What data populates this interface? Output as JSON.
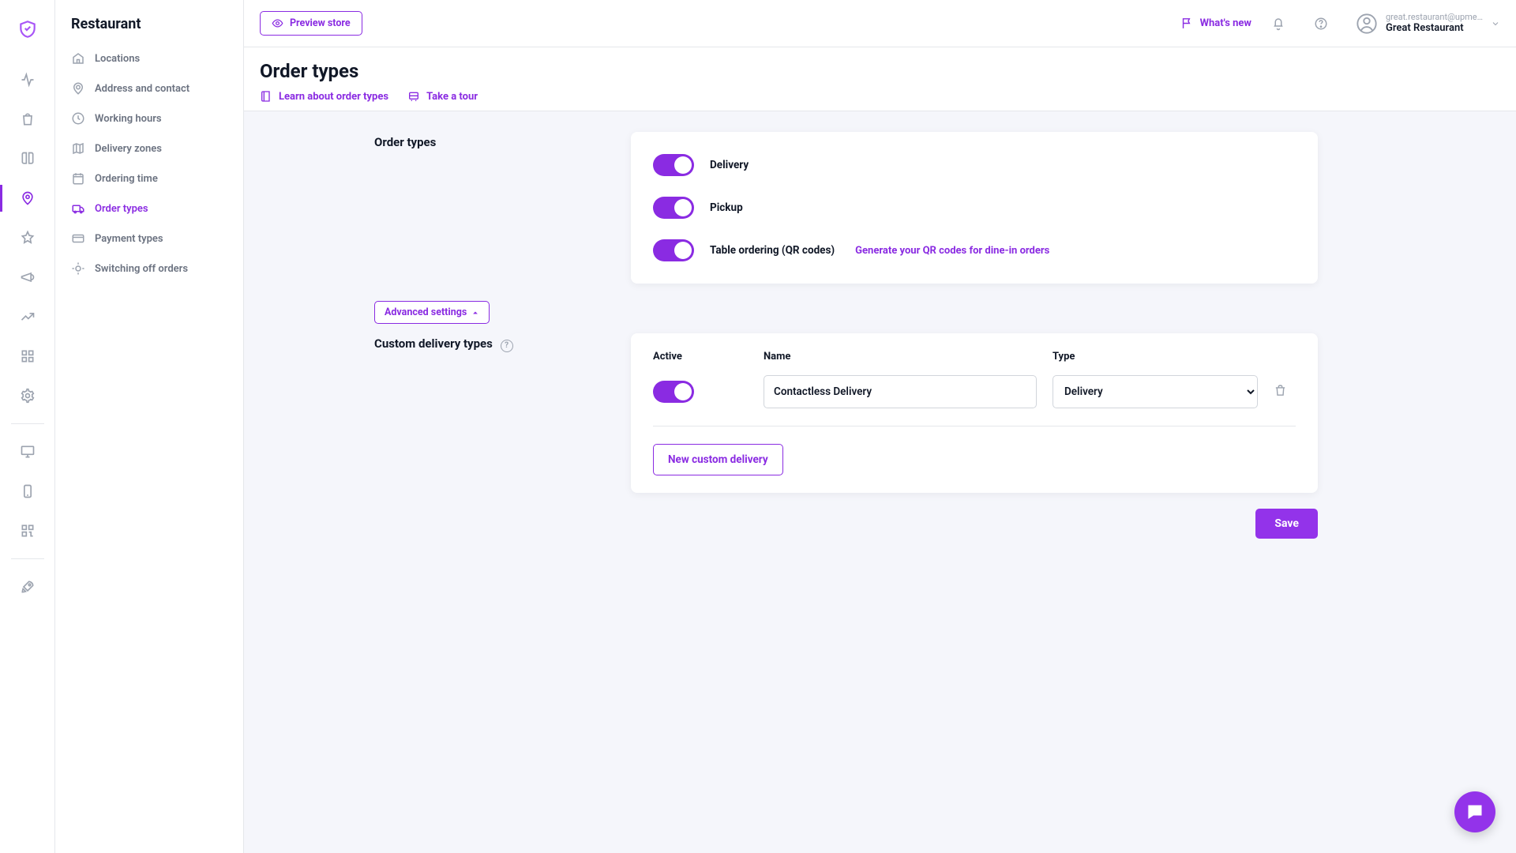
{
  "brand": "Restaurant",
  "topbar": {
    "preview": "Preview store",
    "whats_new": "What's new",
    "account_email": "great.restaurant@upme…",
    "account_name": "Great Restaurant"
  },
  "sidebar": {
    "items": [
      {
        "label": "Locations"
      },
      {
        "label": "Address and contact"
      },
      {
        "label": "Working hours"
      },
      {
        "label": "Delivery zones"
      },
      {
        "label": "Ordering time"
      },
      {
        "label": "Order types"
      },
      {
        "label": "Payment types"
      },
      {
        "label": "Switching off orders"
      }
    ]
  },
  "page": {
    "title": "Order types",
    "learn_link": "Learn about order types",
    "tour_link": "Take a tour"
  },
  "order_types": {
    "section_title": "Order types",
    "items": [
      {
        "label": "Delivery"
      },
      {
        "label": "Pickup"
      },
      {
        "label": "Table ordering (QR codes)",
        "link": "Generate your QR codes for dine-in orders"
      }
    ]
  },
  "advanced_btn": "Advanced settings",
  "custom": {
    "section_title": "Custom delivery types",
    "head_active": "Active",
    "head_name": "Name",
    "head_type": "Type",
    "row_name": "Contactless Delivery",
    "row_type": "Delivery",
    "new_btn": "New custom delivery"
  },
  "save": "Save"
}
